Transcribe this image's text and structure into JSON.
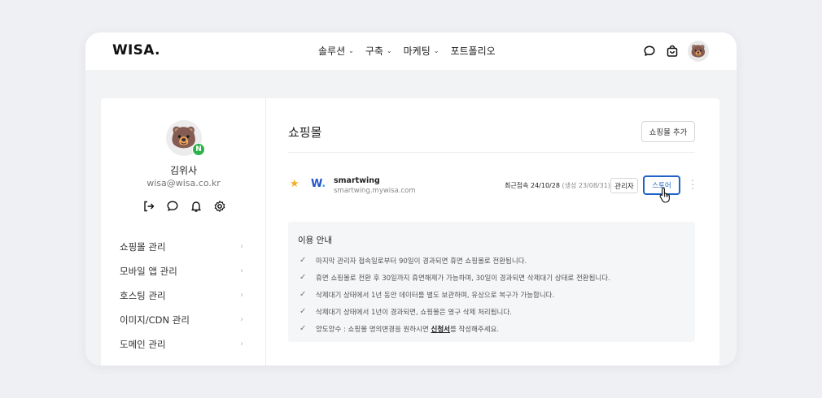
{
  "header": {
    "logo": "WISA.",
    "nav": [
      {
        "label": "솔루션",
        "has_dropdown": true
      },
      {
        "label": "구축",
        "has_dropdown": true
      },
      {
        "label": "마케팅",
        "has_dropdown": true
      },
      {
        "label": "포트폴리오",
        "has_dropdown": false
      }
    ],
    "icons": [
      "chat-icon",
      "cart-icon",
      "bear-avatar"
    ],
    "avatar_emoji": "🐻"
  },
  "profile": {
    "avatar_emoji": "🐻",
    "badge": "N",
    "name": "김위사",
    "email": "wisa@wisa.co.kr",
    "actions": [
      "logout-icon",
      "chat-icon",
      "bell-icon",
      "gear-icon"
    ]
  },
  "sidebar": {
    "items": [
      {
        "label": "쇼핑몰 관리"
      },
      {
        "label": "모바일 앱 관리"
      },
      {
        "label": "호스팅 관리"
      },
      {
        "label": "이미지/CDN 관리"
      },
      {
        "label": "도메인 관리"
      }
    ]
  },
  "main": {
    "title": "쇼핑몰",
    "add_button": "쇼핑몰 추가",
    "shop": {
      "logo": "W",
      "logo_dot": ".",
      "name": "smartwing",
      "url": "smartwing.mywisa.com",
      "last_access": "최근접속 24/10/28",
      "created": "(생성 23/08/31)",
      "admin_button": "관리자",
      "store_button": "스토어"
    }
  },
  "notice": {
    "title": "이용 안내",
    "items": [
      "마지막 관리자 접속일로부터 90일이 경과되면 휴면 쇼핑몰로 전환됩니다.",
      "휴면 쇼핑몰로 전환 후 30일까지 휴면해제가 가능하며, 30일이 경과되면 삭제대기 상태로 전환됩니다.",
      "삭제대기 상태에서 1년 동안 데이터를 별도 보관하며, 유상으로 복구가 가능합니다.",
      "삭제대기 상태에서 1년이 경과되면, 쇼핑몰은 영구 삭제 처리됩니다."
    ],
    "last_item_prefix": "양도양수 : 쇼핑몰 명의변경을 원하시면 ",
    "last_item_link": "신청서",
    "last_item_suffix": "를 작성해주세요."
  },
  "colors": {
    "accent": "#1e63c5",
    "badge_green": "#2db34a",
    "star": "#f2b01e",
    "page_bg": "#eef0f3"
  }
}
